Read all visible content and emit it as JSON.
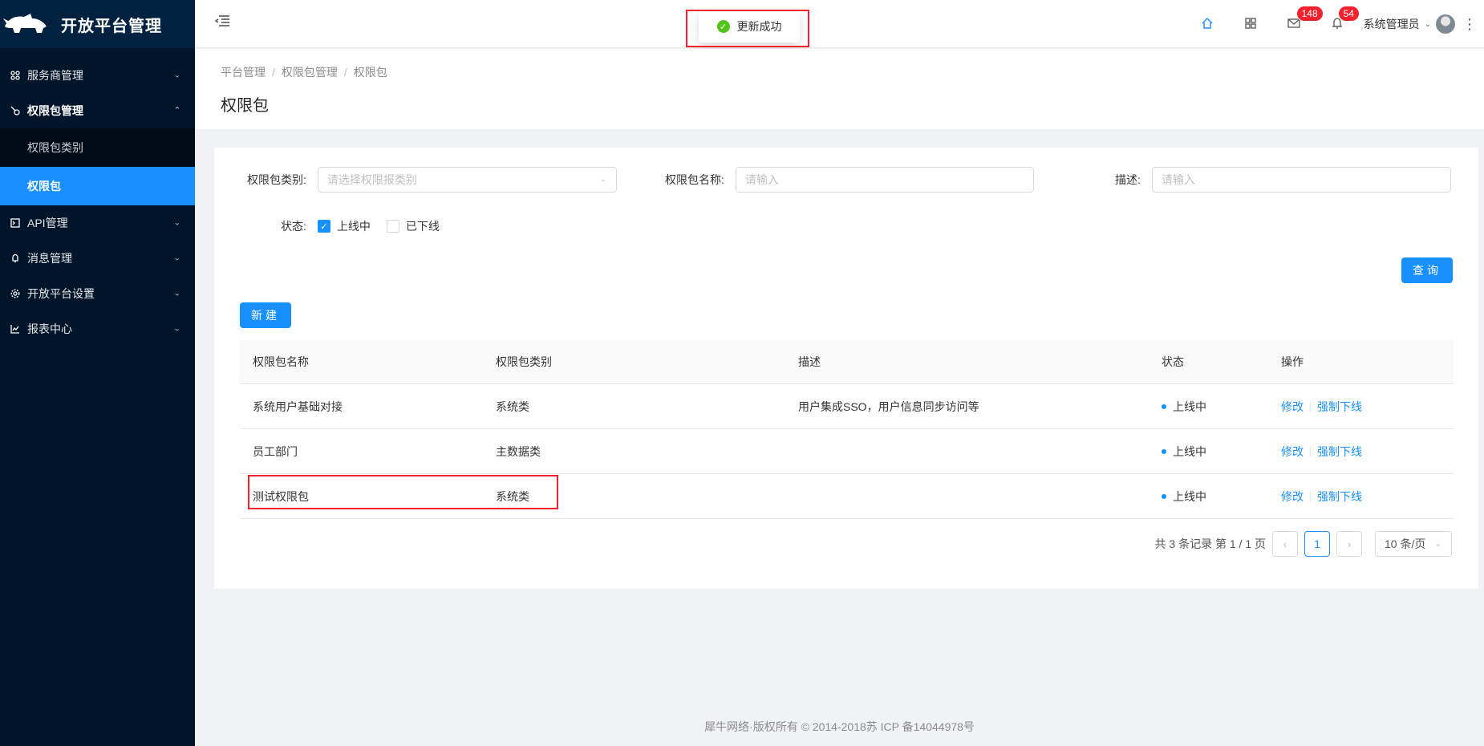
{
  "app": {
    "title": "开放平台管理"
  },
  "sidebar": {
    "items": [
      {
        "label": "服务商管理",
        "icon": "apps-icon"
      },
      {
        "label": "权限包管理",
        "icon": "key-icon"
      },
      {
        "label": "API管理",
        "icon": "code-icon"
      },
      {
        "label": "消息管理",
        "icon": "bell-icon"
      },
      {
        "label": "开放平台设置",
        "icon": "gear-icon"
      },
      {
        "label": "报表中心",
        "icon": "line-chart-icon"
      }
    ],
    "subitems": [
      {
        "label": "权限包类别"
      },
      {
        "label": "权限包"
      }
    ]
  },
  "header": {
    "mail_badge": "148",
    "bell_badge": "54",
    "user_name": "系统管理员"
  },
  "toast": {
    "message": "更新成功"
  },
  "breadcrumb": [
    "平台管理",
    "权限包管理",
    "权限包"
  ],
  "page_title": "权限包",
  "filters": {
    "category_label": "权限包类别:",
    "category_placeholder": "请选择权限报类别",
    "name_label": "权限包名称:",
    "name_placeholder": "请输入",
    "desc_label": "描述:",
    "desc_placeholder": "请输入",
    "status_label": "状态:",
    "status_options": [
      {
        "label": "上线中",
        "checked": true
      },
      {
        "label": "已下线",
        "checked": false
      }
    ],
    "query_button": "查询"
  },
  "new_button": "新建",
  "table": {
    "headers": [
      "权限包名称",
      "权限包类别",
      "描述",
      "状态",
      "操作"
    ],
    "rows": [
      {
        "name": "系统用户基础对接",
        "category": "系统类",
        "desc": "用户集成SSO，用户信息同步访问等",
        "status": "上线中",
        "edit": "修改",
        "offline": "强制下线"
      },
      {
        "name": "员工部门",
        "category": "主数据类",
        "desc": "",
        "status": "上线中",
        "edit": "修改",
        "offline": "强制下线"
      },
      {
        "name": "测试权限包",
        "category": "系统类",
        "desc": "",
        "status": "上线中",
        "edit": "修改",
        "offline": "强制下线"
      }
    ]
  },
  "pagination": {
    "summary": "共 3 条记录 第 1 / 1 页",
    "current": "1",
    "page_size": "10 条/页"
  },
  "footer": "犀牛网络·版权所有 © 2014-2018苏 ICP 备14044978号",
  "colors": {
    "primary": "#1890ff",
    "sidebar": "#001529",
    "highlight": "#f5222d"
  }
}
